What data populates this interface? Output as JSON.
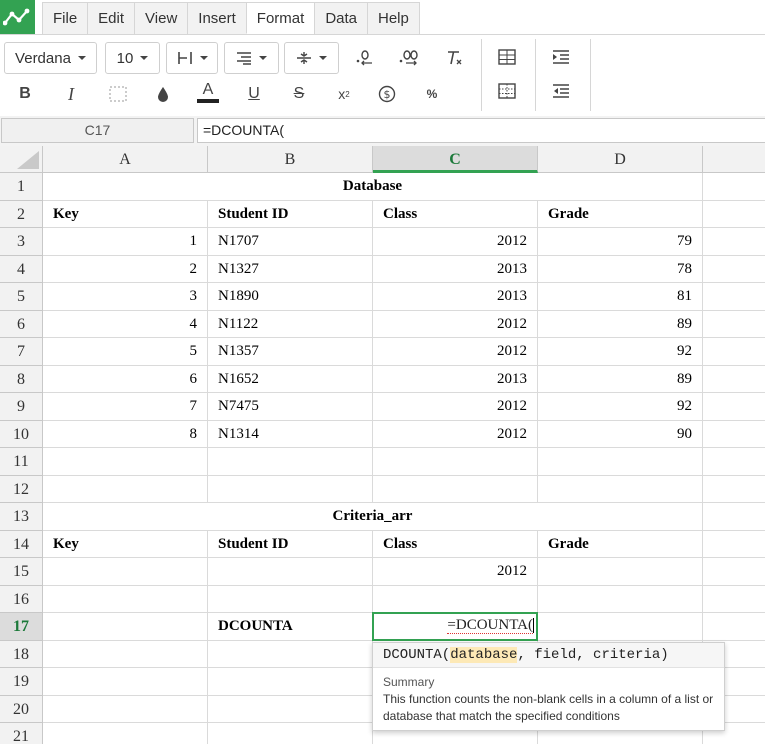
{
  "menu": {
    "tabs": [
      {
        "label": "File"
      },
      {
        "label": "Edit"
      },
      {
        "label": "View"
      },
      {
        "label": "Insert"
      },
      {
        "label": "Format",
        "active": true
      },
      {
        "label": "Data"
      },
      {
        "label": "Help"
      }
    ]
  },
  "toolbar": {
    "font_family": "Verdana",
    "font_size": "10"
  },
  "formula_bar": {
    "cell_ref": "C17",
    "formula": "=DCOUNTA("
  },
  "grid": {
    "columns": [
      "A",
      "B",
      "C",
      "D"
    ],
    "selected_column": "C",
    "selected_row": "17",
    "rows": [
      {
        "num": "1",
        "cells": {
          "title": "Database"
        }
      },
      {
        "num": "2",
        "cells": {
          "A": "Key",
          "B": "Student ID",
          "C": "Class",
          "D": "Grade"
        }
      },
      {
        "num": "3",
        "cells": {
          "A": "1",
          "B": "N1707",
          "C": "2012",
          "D": "79"
        }
      },
      {
        "num": "4",
        "cells": {
          "A": "2",
          "B": "N1327",
          "C": "2013",
          "D": "78"
        }
      },
      {
        "num": "5",
        "cells": {
          "A": "3",
          "B": "N1890",
          "C": "2013",
          "D": "81"
        }
      },
      {
        "num": "6",
        "cells": {
          "A": "4",
          "B": "N1122",
          "C": "2012",
          "D": "89"
        }
      },
      {
        "num": "7",
        "cells": {
          "A": "5",
          "B": "N1357",
          "C": "2012",
          "D": "92"
        }
      },
      {
        "num": "8",
        "cells": {
          "A": "6",
          "B": "N1652",
          "C": "2013",
          "D": "89"
        }
      },
      {
        "num": "9",
        "cells": {
          "A": "7",
          "B": "N7475",
          "C": "2012",
          "D": "92"
        }
      },
      {
        "num": "10",
        "cells": {
          "A": "8",
          "B": "N1314",
          "C": "2012",
          "D": "90"
        }
      },
      {
        "num": "11",
        "cells": {}
      },
      {
        "num": "12",
        "cells": {}
      },
      {
        "num": "13",
        "cells": {
          "title": "Criteria_arr"
        }
      },
      {
        "num": "14",
        "cells": {
          "A": "Key",
          "B": "Student ID",
          "C": "Class",
          "D": "Grade"
        }
      },
      {
        "num": "15",
        "cells": {
          "C": "2012"
        }
      },
      {
        "num": "16",
        "cells": {}
      },
      {
        "num": "17",
        "cells": {
          "B": "DCOUNTA",
          "C": "=DCOUNTA("
        }
      },
      {
        "num": "18",
        "cells": {}
      },
      {
        "num": "19",
        "cells": {}
      },
      {
        "num": "20",
        "cells": {}
      },
      {
        "num": "21",
        "cells": {}
      }
    ]
  },
  "tooltip": {
    "fn_name": "DCOUNTA(",
    "param_active": "database",
    "params_rest": ", field, criteria)",
    "summary_label": "Summary",
    "description": "This function counts the non-blank cells in a column of a list or database that match the specified conditions"
  },
  "colors": {
    "accent": "#33a252"
  }
}
